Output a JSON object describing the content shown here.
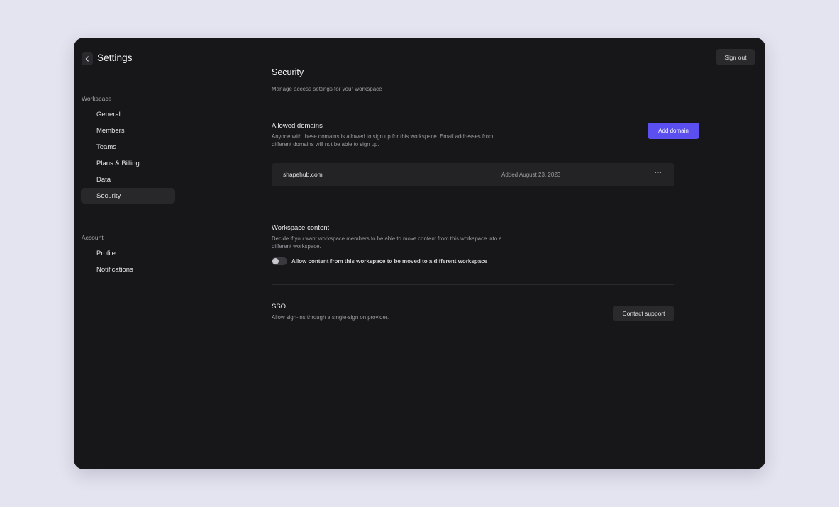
{
  "sidebar": {
    "title": "Settings",
    "workspace_label": "Workspace",
    "workspace_items": [
      {
        "label": "General"
      },
      {
        "label": "Members"
      },
      {
        "label": "Teams"
      },
      {
        "label": "Plans & Billing"
      },
      {
        "label": "Data"
      },
      {
        "label": "Security"
      }
    ],
    "account_label": "Account",
    "account_items": [
      {
        "label": "Profile"
      },
      {
        "label": "Notifications"
      }
    ]
  },
  "header": {
    "signout_label": "Sign out"
  },
  "security": {
    "title": "Security",
    "subtitle": "Manage access settings for your workspace",
    "allowed_domains": {
      "title": "Allowed domains",
      "desc_line1": "Anyone with these domains is allowed to sign up for this workspace. Email addresses from",
      "desc_line2": "different domains will not be able to sign up.",
      "add_label": "Add domain",
      "domains": [
        {
          "name": "shapehub.com",
          "added": "Added August 23, 2023",
          "more": "···"
        }
      ]
    },
    "workspace_content": {
      "title": "Workspace content",
      "desc_line1": "Decide if you want workspace members to be able to move content from this workspace into a",
      "desc_line2": "different workspace.",
      "toggle_label": "Allow content from this workspace to be moved to a different workspace",
      "toggle_on": false
    },
    "sso": {
      "title": "SSO",
      "desc": "Allow sign-ins through a single-sign on provider.",
      "contact_label": "Contact support"
    }
  },
  "colors": {
    "accent": "#5b4ff0",
    "window_bg": "#171719",
    "page_bg": "#e4e4f0",
    "active_nav_bg": "#28282b"
  }
}
